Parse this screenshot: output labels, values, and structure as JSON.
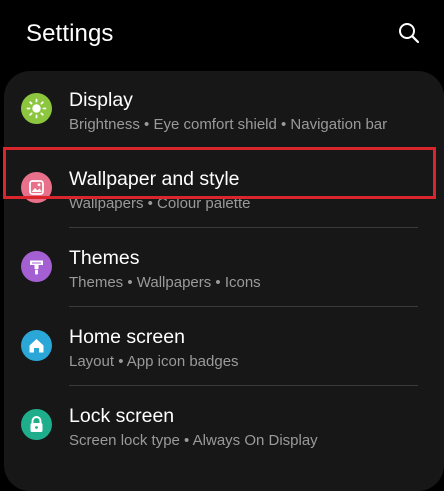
{
  "header": {
    "title": "Settings",
    "search_icon": "search-icon"
  },
  "items": [
    {
      "key": "display",
      "title": "Display",
      "subtitle": "Brightness  •  Eye comfort shield  •  Navigation bar",
      "icon": "sun-icon",
      "icon_color": "#8cc63f"
    },
    {
      "key": "wallpaper",
      "title": "Wallpaper and style",
      "subtitle": "Wallpapers  •  Colour palette",
      "icon": "image-icon",
      "icon_color": "#e8708a"
    },
    {
      "key": "themes",
      "title": "Themes",
      "subtitle": "Themes  •  Wallpapers  •  Icons",
      "icon": "brush-icon",
      "icon_color": "#a45fd2"
    },
    {
      "key": "home",
      "title": "Home screen",
      "subtitle": "Layout  •  App icon badges",
      "icon": "home-icon",
      "icon_color": "#2aa7d6"
    },
    {
      "key": "lock",
      "title": "Lock screen",
      "subtitle": "Screen lock type  •  Always On Display",
      "icon": "lock-icon",
      "icon_color": "#1fae8c"
    }
  ],
  "colors": {
    "background": "#000000",
    "card": "#171717",
    "highlight_border": "#d9262c",
    "subtitle_text": "#9a9a9a"
  }
}
